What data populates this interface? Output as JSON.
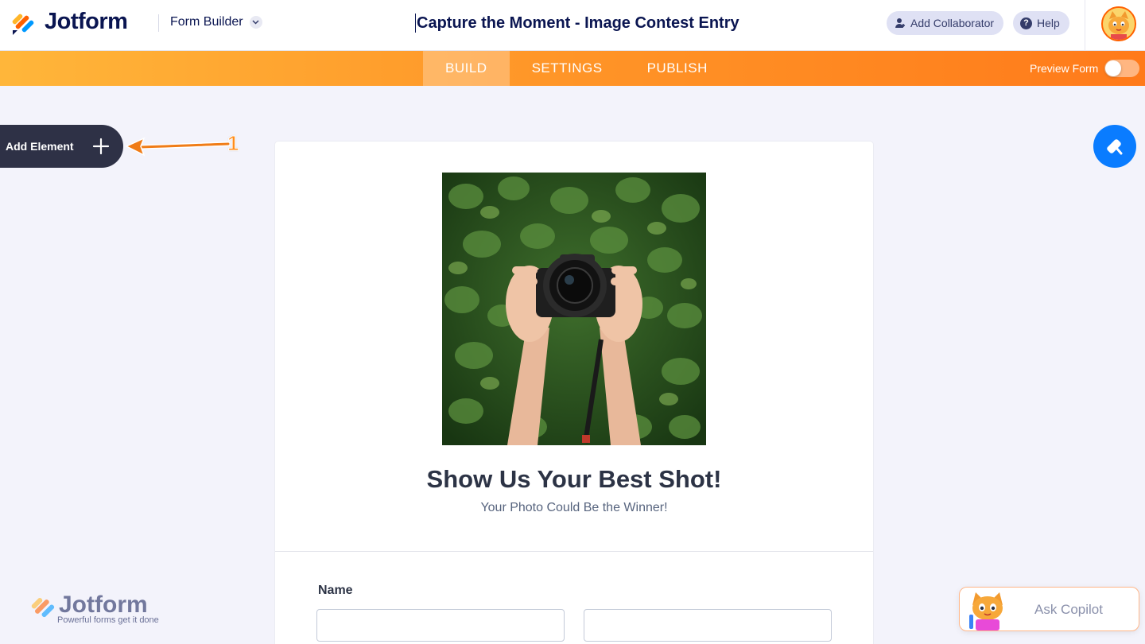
{
  "header": {
    "brand": "Jotform",
    "product_menu": "Form Builder",
    "form_title": "Capture the Moment - Image Contest Entry",
    "add_collaborator": "Add Collaborator",
    "help": "Help"
  },
  "nav": {
    "tabs": [
      {
        "label": "BUILD",
        "active": true
      },
      {
        "label": "SETTINGS",
        "active": false
      },
      {
        "label": "PUBLISH",
        "active": false
      }
    ],
    "preview_label": "Preview Form",
    "preview_enabled": false
  },
  "sidebar": {
    "add_element": "Add Element"
  },
  "annotation": {
    "number": "1"
  },
  "form": {
    "heading": "Show Us Your Best Shot!",
    "subheading": "Your Photo Could Be the Winner!",
    "fields": [
      {
        "label": "Name"
      }
    ]
  },
  "watermark": {
    "brand": "Jotform",
    "tagline": "Powerful forms get it done"
  },
  "copilot": {
    "label": "Ask Copilot"
  },
  "colors": {
    "brand_navy": "#0a1551",
    "accent_orange": "#ff7a1a",
    "designer_blue": "#0a7cff",
    "sidebar_dark": "#2e3146"
  },
  "icons": [
    "jotform-logo-icon",
    "chevron-down-icon",
    "add-user-icon",
    "help-icon",
    "avatar-icon",
    "plus-icon",
    "paint-roller-icon",
    "arrow-icon",
    "copilot-cat-icon"
  ]
}
